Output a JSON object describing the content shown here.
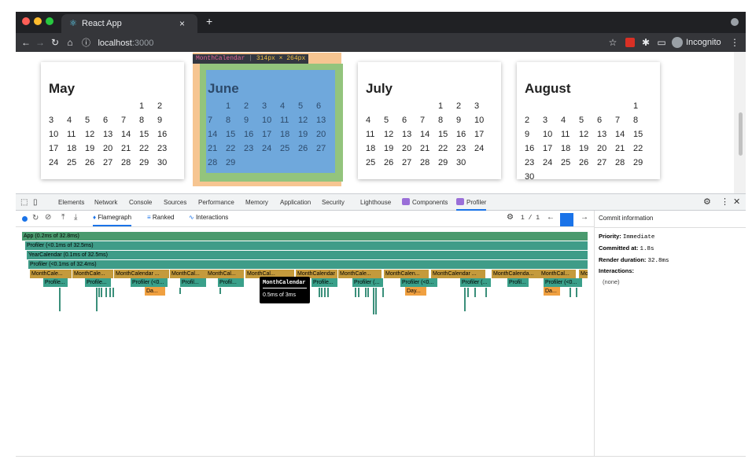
{
  "browser": {
    "tab_title": "React App",
    "tab_close": "×",
    "new_tab": "+",
    "url_host": "localhost",
    "url_port": ":3000",
    "profile_label": "Incognito",
    "colors": {
      "tabbar": "#202124",
      "toolbar": "#35363a"
    }
  },
  "highlight": {
    "component": "MonthCalendar",
    "size": "314px × 264px"
  },
  "calendars": [
    {
      "title": "May",
      "cells": [
        "",
        "",
        "",
        "",
        "",
        "1",
        "2",
        "3",
        "4",
        "5",
        "6",
        "7",
        "8",
        "9",
        "10",
        "11",
        "12",
        "13",
        "14",
        "15",
        "16",
        "17",
        "18",
        "19",
        "20",
        "21",
        "22",
        "23",
        "24",
        "25",
        "26",
        "27",
        "28",
        "29",
        "30"
      ]
    },
    {
      "title": "June",
      "cells": [
        "",
        "1",
        "2",
        "3",
        "4",
        "5",
        "6",
        "7",
        "8",
        "9",
        "10",
        "11",
        "12",
        "13",
        "14",
        "15",
        "16",
        "17",
        "18",
        "19",
        "20",
        "21",
        "22",
        "23",
        "24",
        "25",
        "26",
        "27",
        "28",
        "29"
      ]
    },
    {
      "title": "July",
      "cells": [
        "",
        "",
        "",
        "",
        "1",
        "2",
        "3",
        "4",
        "5",
        "6",
        "7",
        "8",
        "9",
        "10",
        "11",
        "12",
        "13",
        "14",
        "15",
        "16",
        "17",
        "18",
        "19",
        "20",
        "21",
        "22",
        "23",
        "24",
        "25",
        "26",
        "27",
        "28",
        "29",
        "30"
      ]
    },
    {
      "title": "August",
      "cells": [
        "",
        "",
        "",
        "",
        "",
        "",
        "1",
        "2",
        "3",
        "4",
        "5",
        "6",
        "7",
        "8",
        "9",
        "10",
        "11",
        "12",
        "13",
        "14",
        "15",
        "16",
        "17",
        "18",
        "19",
        "20",
        "21",
        "22",
        "23",
        "24",
        "25",
        "26",
        "27",
        "28",
        "29",
        "30"
      ]
    }
  ],
  "devtools": {
    "tabs": [
      "Elements",
      "Network",
      "Console",
      "Sources",
      "Performance",
      "Memory",
      "Application",
      "Security",
      "Lighthouse",
      "Components",
      "Profiler"
    ],
    "active_tab": "Profiler"
  },
  "profiler": {
    "views": {
      "flamegraph": "Flamegraph",
      "ranked": "Ranked",
      "interactions": "Interactions"
    },
    "commit_counter": "1 / 1",
    "flame_rows": [
      {
        "label": "App (0.2ms of 32.8ms)"
      },
      {
        "label": "Profiler (<0.1ms of 32.5ms)"
      },
      {
        "label": "YearCalendar (0.1ms of 32.5ms)"
      },
      {
        "label": "Profiler (<0.1ms of 32.4ms)"
      }
    ],
    "month_bars": [
      "MonthCale...",
      "MonthCale...",
      "MonthCalendar ...",
      "MonthCal...",
      "MonthCal...",
      "MonthCal...",
      "MonthCalendar",
      "MonthCale...",
      "MonthCalen...",
      "MonthCalendar ...",
      "MonthCalenda...",
      "MonthCal...",
      "MonthCalendar k..."
    ],
    "profiler_bars": [
      "Profile...",
      "Profile...",
      "Profiler (<0...",
      "Profil...",
      "Profil...",
      "Profile...",
      "Profiler (...",
      "Profiler (<0...",
      "Profiler (...",
      "Profil...",
      "Profiler (<0..."
    ],
    "day_bars": [
      "Da...",
      "Day...",
      "Da..."
    ],
    "tooltip": {
      "name": "MonthCalendar",
      "duration": "0.5ms of 3ms"
    },
    "colors": {
      "app": "#3a8f6a",
      "profiler": "#3a9a85",
      "month": "#c49a3c",
      "child": "#3aa08a",
      "day": "#f0a040"
    }
  },
  "commit_info": {
    "heading": "Commit information",
    "priority_label": "Priority:",
    "priority_value": "Immediate",
    "committed_label": "Committed at:",
    "committed_value": "1.8s",
    "render_label": "Render duration:",
    "render_value": "32.8ms",
    "interactions_label": "Interactions:",
    "interactions_value": "(none)"
  }
}
